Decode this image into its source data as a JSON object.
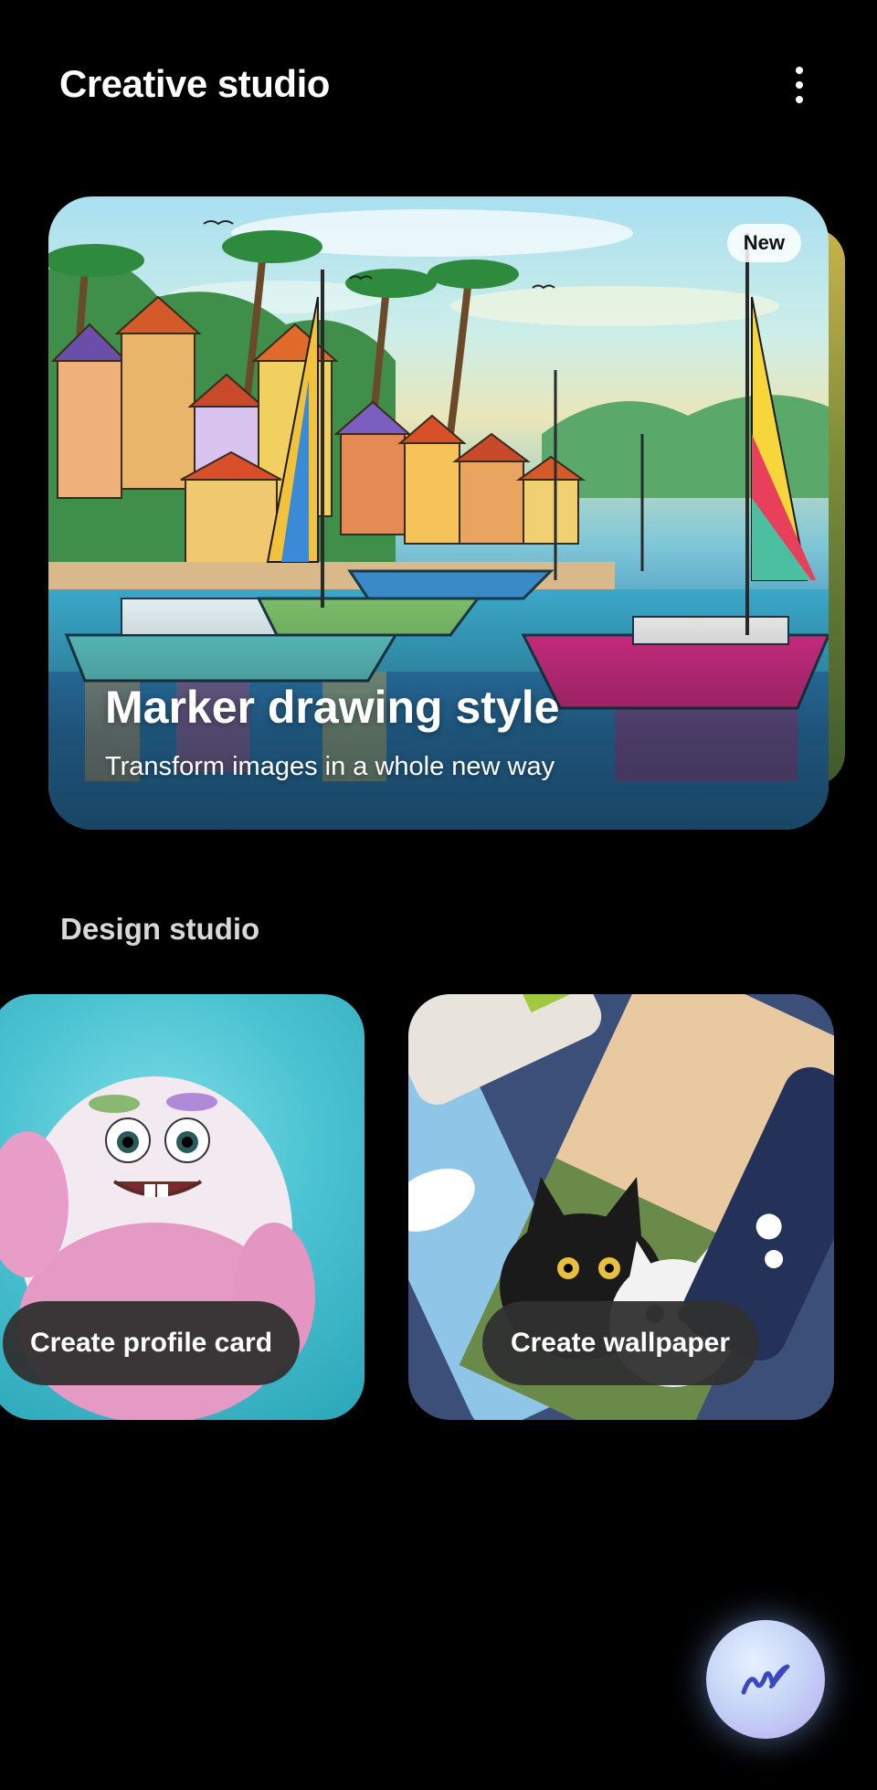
{
  "header": {
    "title": "Creative studio",
    "menu_icon": "more-vertical-icon"
  },
  "hero": {
    "badge": "New",
    "title": "Marker drawing style",
    "subtitle": "Transform images in a whole new way",
    "image": "marker-drawing-harbor-image"
  },
  "design_studio": {
    "title": "Design studio",
    "tiles": [
      {
        "label": "Create profile card",
        "image": "fluffy-monster-image"
      },
      {
        "label": "Create wallpaper",
        "image": "cats-wallpaper-collage-image"
      }
    ]
  },
  "fab": {
    "icon": "pen-scribble-icon"
  },
  "colors": {
    "background": "#000000",
    "pill": "#303030",
    "fab_glow": "#b8c8ff"
  }
}
